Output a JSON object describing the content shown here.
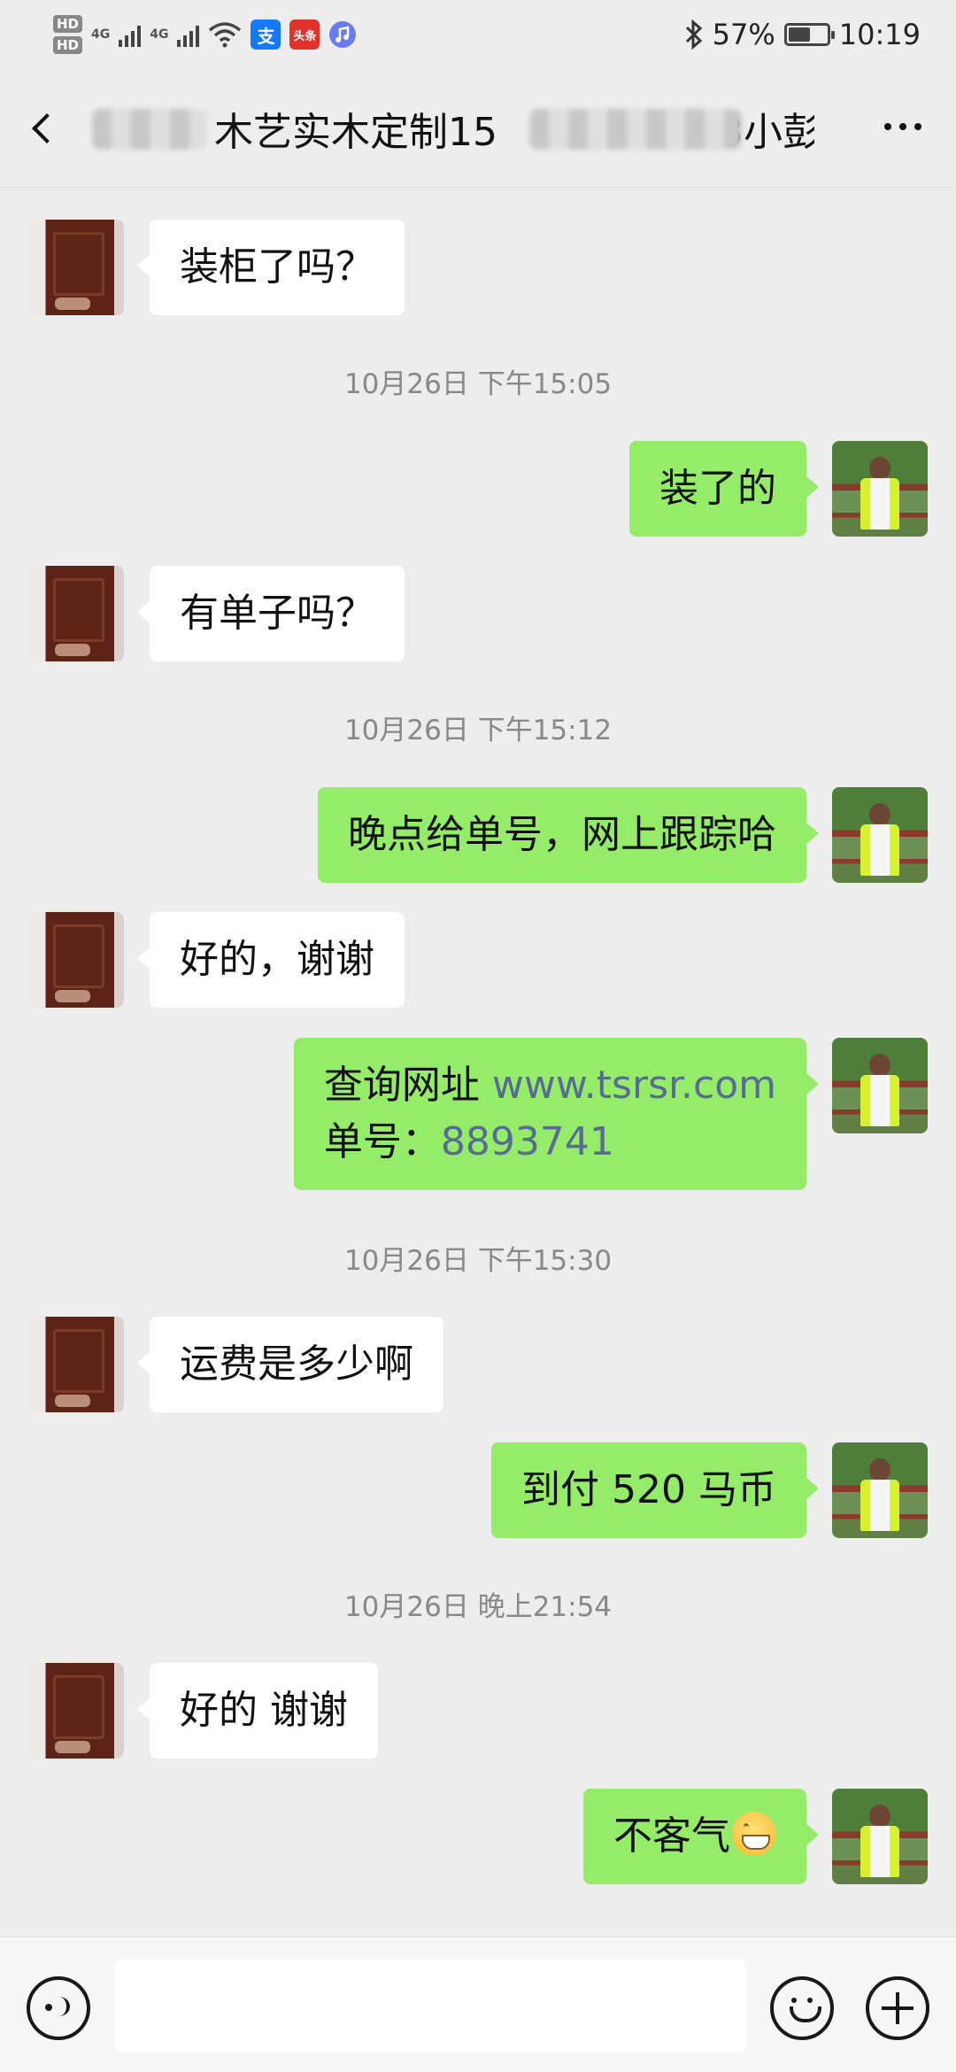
{
  "status_bar": {
    "hd1": "HD",
    "hd2": "HD",
    "net1": "4G",
    "net2": "4G",
    "alipay_icon_text": "支",
    "toutiao_icon_text": "头条",
    "battery_percent": "57%",
    "battery_level": 0.57,
    "time": "10:19",
    "icons": [
      "signal-icon",
      "wifi-icon",
      "alipay-icon",
      "toutiao-icon",
      "music-icon",
      "bluetooth-icon",
      "battery-icon"
    ]
  },
  "header": {
    "title_visible": "木艺实木定制15",
    "title_tail": "3小彭",
    "back_icon": "chevron-left-icon",
    "more_icon": "more-dots-icon"
  },
  "messages": [
    {
      "side": "in",
      "text": "装柜了吗？"
    },
    {
      "timestamp": "10月26日 下午15:05"
    },
    {
      "side": "out",
      "text": "装了的"
    },
    {
      "side": "in",
      "text": "有单子吗？"
    },
    {
      "timestamp": "10月26日 下午15:12"
    },
    {
      "side": "out",
      "text": "晚点给单号，网上跟踪哈"
    },
    {
      "side": "in",
      "text": "好的，谢谢"
    },
    {
      "side": "out",
      "line1_prefix": "查询网址 ",
      "line1_link": "www.tsrsr.com",
      "line2_prefix": "单号：",
      "line2_link": "8893741"
    },
    {
      "timestamp": "10月26日 下午15:30"
    },
    {
      "side": "in",
      "text": "运费是多少啊"
    },
    {
      "side": "out",
      "text": "到付 520 马币"
    },
    {
      "timestamp": "10月26日 晚上21:54"
    },
    {
      "side": "in",
      "text": "好的 谢谢"
    },
    {
      "side": "out",
      "text": "不客气",
      "emoji": "grinning-face-icon"
    }
  ],
  "colors": {
    "background": "#ededed",
    "incoming_bubble": "#ffffff",
    "outgoing_bubble": "#95ec69",
    "link": "#576b95",
    "timestamp": "#888888"
  },
  "input_bar": {
    "placeholder": "",
    "voice_icon": "voice-icon",
    "emoji_icon": "emoji-icon",
    "plus_icon": "plus-icon"
  }
}
